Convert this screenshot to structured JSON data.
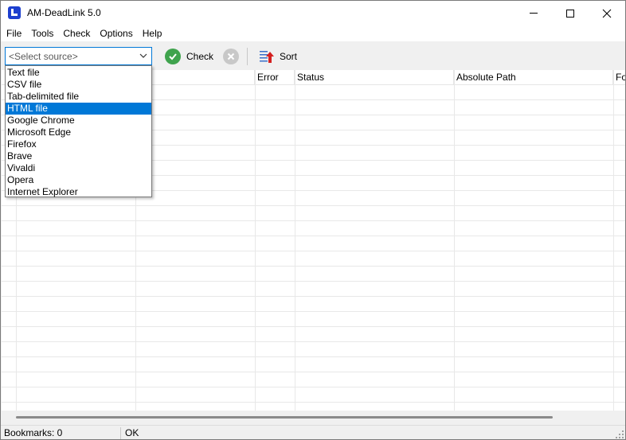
{
  "window": {
    "title": "AM-DeadLink 5.0",
    "icon": "app-icon",
    "controls": [
      "minimize-icon",
      "maximize-icon",
      "close-icon"
    ]
  },
  "menubar": {
    "items": [
      "File",
      "Tools",
      "Check",
      "Options",
      "Help"
    ]
  },
  "toolbar": {
    "source_placeholder": "<Select source>",
    "check_label": "Check",
    "sort_label": "Sort",
    "accent_color": "#0078d7"
  },
  "dropdown": {
    "options": [
      "Text file",
      "CSV file",
      "Tab-delimited file",
      "HTML file",
      "Google Chrome",
      "Microsoft Edge",
      "Firefox",
      "Brave",
      "Vivaldi",
      "Opera",
      "Internet Explorer"
    ],
    "selected_index": 3,
    "highlight_color": "#0078d7"
  },
  "grid": {
    "columns": [
      "",
      "",
      "",
      "Error",
      "Status",
      "Absolute Path",
      "Fo"
    ]
  },
  "statusbar": {
    "bookmarks": "Bookmarks: 0",
    "state": "OK"
  }
}
